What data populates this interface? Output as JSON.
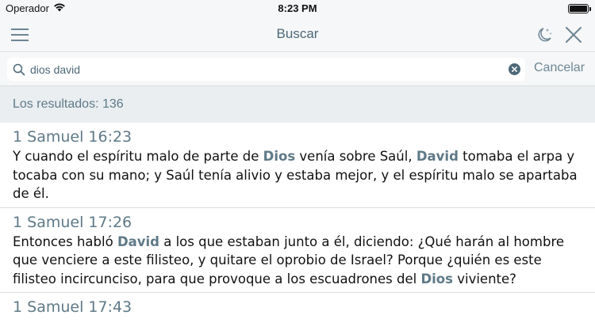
{
  "status_bar": {
    "carrier": "Operador",
    "time": "8:23 PM"
  },
  "nav": {
    "title": "Buscar",
    "menu_icon": "hamburger-icon",
    "night_icon": "moon-stars-icon",
    "close_icon": "close-icon"
  },
  "search": {
    "value": "dios david",
    "placeholder": "",
    "cancel_label": "Cancelar"
  },
  "results": {
    "count_label": "Los resultados: 136",
    "items": [
      {
        "reference": "1 Samuel 16:23",
        "segments": [
          {
            "text": "Y cuando el espíritu malo de parte de ",
            "highlight": false
          },
          {
            "text": "Dios",
            "highlight": true
          },
          {
            "text": " venía sobre Saúl, ",
            "highlight": false
          },
          {
            "text": "David",
            "highlight": true
          },
          {
            "text": " tomaba el arpa y tocaba con su mano; y Saúl tenía alivio y estaba mejor, y el espíritu malo se apartaba de él.",
            "highlight": false
          }
        ]
      },
      {
        "reference": "1 Samuel 17:26",
        "segments": [
          {
            "text": "Entonces habló ",
            "highlight": false
          },
          {
            "text": "David",
            "highlight": true
          },
          {
            "text": " a los que estaban junto a él, diciendo: ¿Qué harán al hombre que venciere a este filisteo, y quitare el oprobio de Israel? Porque ¿quién es este filisteo incircunciso, para que provoque a los escuadrones del ",
            "highlight": false
          },
          {
            "text": "Dios",
            "highlight": true
          },
          {
            "text": " viviente?",
            "highlight": false
          }
        ]
      },
      {
        "reference": "1 Samuel 17:43",
        "segments": []
      }
    ]
  },
  "colors": {
    "accent": "#5f7987",
    "bar_background": "#f6f7f8",
    "header_background": "#eaeef1"
  }
}
